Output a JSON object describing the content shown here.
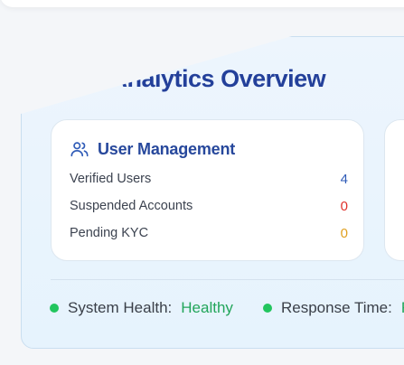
{
  "panel": {
    "title": "Platform Analytics Overview"
  },
  "user_management": {
    "title": "User Management",
    "icon": "users-icon",
    "stats": [
      {
        "label": "Verified Users",
        "value": "4",
        "color": "#2f5bb7"
      },
      {
        "label": "Suspended Accounts",
        "value": "0",
        "color": "#e0322c"
      },
      {
        "label": "Pending KYC",
        "value": "0",
        "color": "#e0a020"
      }
    ]
  },
  "status_bar": {
    "system_health_label": "System Health:",
    "system_health_value": "Healthy",
    "response_time_label": "Response Time:",
    "response_time_value": "F"
  },
  "colors": {
    "accent": "#23409a",
    "healthy": "#22c55e"
  }
}
